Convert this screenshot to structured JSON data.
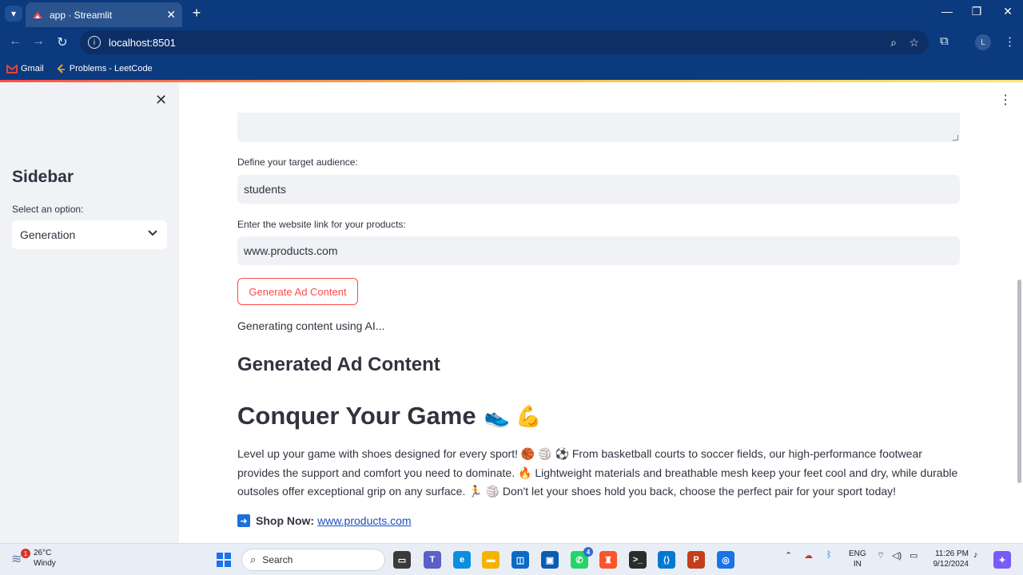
{
  "browser": {
    "tab_title": "app · Streamlit",
    "address": "localhost:8501",
    "profile_initial": "L",
    "bookmarks": [
      {
        "label": "Gmail"
      },
      {
        "label": "Problems - LeetCode"
      }
    ]
  },
  "sidebar": {
    "title": "Sidebar",
    "select_label": "Select an option:",
    "select_value": "Generation"
  },
  "form": {
    "audience_label": "Define your target audience:",
    "audience_value": "students",
    "website_label": "Enter the website link for your products:",
    "website_value": "www.products.com",
    "generate_button": "Generate Ad Content",
    "status": "Generating content using AI..."
  },
  "result": {
    "section_title": "Generated Ad Content",
    "headline": "Conquer Your Game",
    "headline_emoji": "👟 💪",
    "body": "Level up your game with shoes designed for every sport! 🏀 🏐 ⚽ From basketball courts to soccer fields, our high-performance footwear provides the support and comfort you need to dominate. 🔥 Lightweight materials and breathable mesh keep your feet cool and dry, while durable outsoles offer exceptional grip on any surface. 🏃 🏐 Don't let your shoes hold you back, choose the perfect pair for your sport today!",
    "shop_label": "Shop Now:",
    "shop_link": "www.products.com"
  },
  "taskbar": {
    "weather_temp": "26°C",
    "weather_desc": "Windy",
    "weather_badge": "1",
    "search_placeholder": "Search",
    "whatsapp_badge": "4",
    "lang_line1": "ENG",
    "lang_line2": "IN",
    "time": "11:26 PM",
    "date": "9/12/2024"
  },
  "colors": {
    "chrome_bg": "#0b3a7e",
    "streamlit_red": "#ff4b4b",
    "sidebar_bg": "#f0f2f6",
    "text": "#31333f"
  }
}
